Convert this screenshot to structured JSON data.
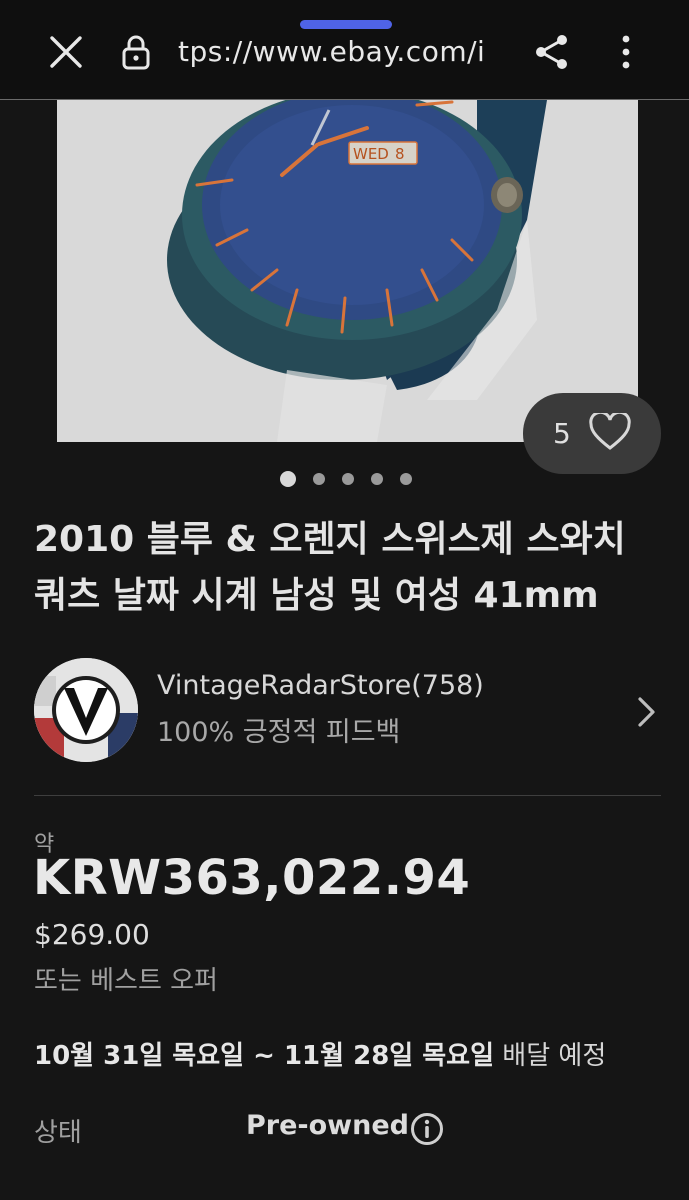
{
  "browser": {
    "url": "tps://www.ebay.com/i",
    "icons": [
      "close-icon",
      "lock-icon",
      "share-icon",
      "more-vert-icon"
    ]
  },
  "gallery": {
    "favorite_count": "5",
    "image_count": 5,
    "active_index": 0
  },
  "listing": {
    "title": "2010 블루 & 오렌지 스위스제 스와치 쿼츠 날짜 시계 남성 및 여성 41mm"
  },
  "seller": {
    "name": "VintageRadarStore(758)",
    "feedback": "100% 긍정적 피드백"
  },
  "price": {
    "approx_label": "약",
    "converted": "KRW363,022.94",
    "original": "$269.00",
    "best_offer": "또는 베스트 오퍼"
  },
  "delivery": {
    "dates": "10월 31일 목요일 ~ 11월 28일 목요일",
    "suffix": " 배달 예정"
  },
  "condition": {
    "label": "상태",
    "value": "Pre-owned"
  },
  "colors": {
    "background": "#151515",
    "accent": "#4f63e6",
    "watch_face": "#2f4a84",
    "watch_hands": "#d8743a"
  }
}
